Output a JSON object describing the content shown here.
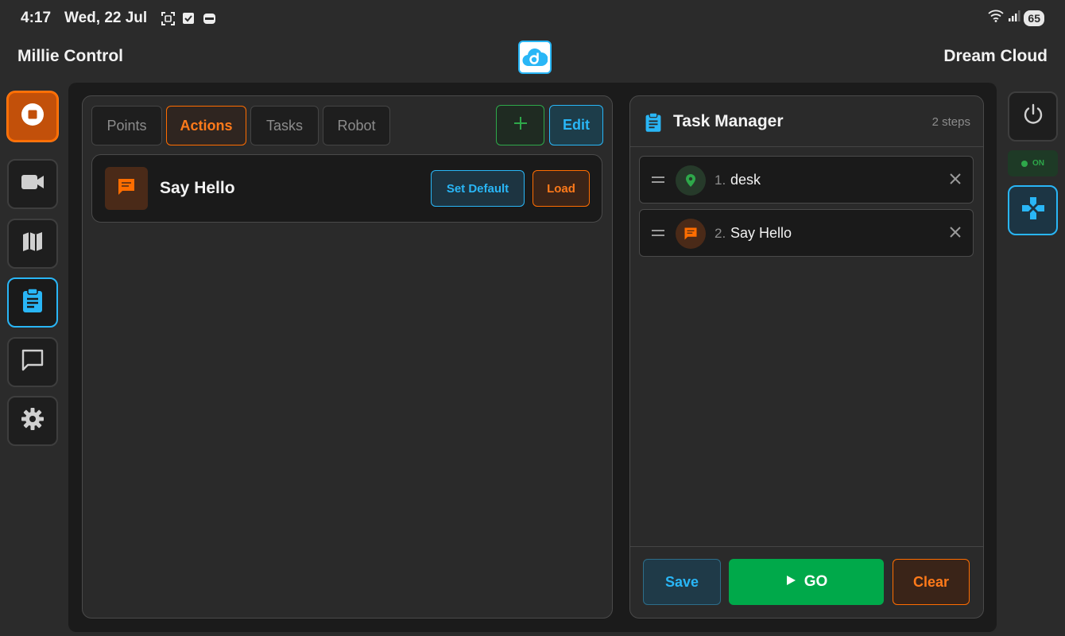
{
  "status_bar": {
    "time": "4:17",
    "date": "Wed, 22 Jul",
    "battery": "65",
    "left_icons": [
      "screenshot-icon",
      "check-box-icon",
      "card-icon"
    ],
    "right_icons": [
      "wifi-icon",
      "signal-icon"
    ]
  },
  "header": {
    "app_title": "Millie Control",
    "brand_title": "Dream Cloud",
    "logo_icon": "dream-cloud-logo"
  },
  "left_nav": [
    {
      "id": "stop",
      "icon": "stop-icon"
    },
    {
      "id": "camera",
      "icon": "video-camera-icon"
    },
    {
      "id": "map",
      "icon": "map-icon"
    },
    {
      "id": "tasks",
      "icon": "clipboard-icon",
      "active": true
    },
    {
      "id": "chat",
      "icon": "chat-icon"
    },
    {
      "id": "settings",
      "icon": "gear-icon"
    }
  ],
  "library": {
    "tabs": [
      {
        "label": "Points",
        "active": false
      },
      {
        "label": "Actions",
        "active": true
      },
      {
        "label": "Tasks",
        "active": false
      },
      {
        "label": "Robot",
        "active": false
      }
    ],
    "add_label": "+",
    "edit_label": "Edit",
    "items": [
      {
        "title": "Say Hello",
        "icon": "chat-bubble-icon",
        "set_default_label": "Set Default",
        "load_label": "Load"
      }
    ]
  },
  "task_manager": {
    "title": "Task Manager",
    "count_label": "2 steps",
    "steps": [
      {
        "number": "1.",
        "label": "desk",
        "icon": "location-pin-icon",
        "icon_color": "#2ea84a"
      },
      {
        "number": "2.",
        "label": "Say Hello",
        "icon": "chat-bubble-icon",
        "icon_color": "#ff6d00"
      }
    ],
    "save_label": "Save",
    "go_label": "GO",
    "clear_label": "Clear"
  },
  "right_rail": {
    "power_icon": "power-icon",
    "status_label": "ON",
    "gamepad_icon": "gamepad-icon"
  },
  "colors": {
    "accent_blue": "#29b6f6",
    "accent_orange": "#ff6d00",
    "accent_green": "#00a94a",
    "background": "#2b2b2b"
  }
}
